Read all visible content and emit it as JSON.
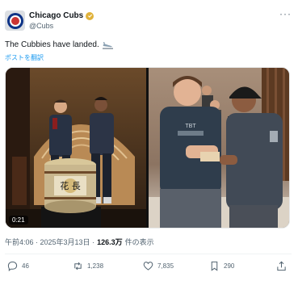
{
  "account": {
    "display_name": "Chicago Cubs",
    "handle": "@Cubs"
  },
  "tweet": {
    "text": "The Cubbies have landed.",
    "translate_label": "ポストを翻訳"
  },
  "media": {
    "video_duration": "0:21",
    "barrel_text": "花 長"
  },
  "meta": {
    "timestamp": "午前4:06 · 2025年3月13日 ·",
    "views_count": "126.3万",
    "views_label": "件の表示"
  },
  "actions": {
    "replies": "46",
    "reposts": "1,238",
    "likes": "7,835",
    "bookmarks": "290"
  },
  "colors": {
    "accent": "#1d9bf0",
    "text": "#0f1419",
    "muted": "#536471",
    "cubs_blue": "#0e3386",
    "cubs_red": "#cc3433"
  }
}
